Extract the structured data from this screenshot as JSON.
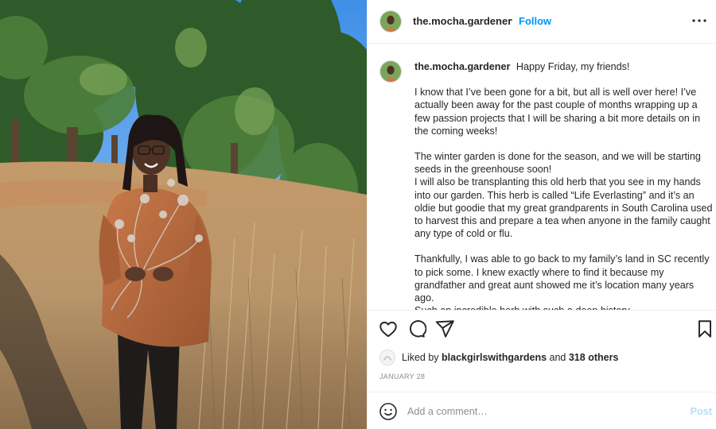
{
  "post": {
    "username": "the.mocha.gardener",
    "follow_label": "Follow",
    "separator": "·",
    "photo_alt": "Woman in a rust sweater holding dried herbs in a pine field"
  },
  "caption": {
    "username": "the.mocha.gardener",
    "first_line": "Happy Friday, my friends!",
    "paragraphs": [
      "I know that I’ve been gone for a bit, but all is well over here! I’ve actually been away for the past couple of months wrapping up a few passion projects that I will be sharing a bit more details on in the coming weeks!",
      "The winter garden is done for the season, and we will be starting seeds in the greenhouse soon!\nI will also be transplanting this old herb that you see in my hands into our garden. This herb is called “Life Everlasting” and it’s an oldie but goodie that my great grandparents in South Carolina used to harvest this and prepare a tea when anyone in the family caught any type of cold or flu.",
      "Thankfully, I was able to go back to my family’s land in SC recently to pick some. I knew exactly where to find it because my grandfather and great aunt showed me it’s location many years ago.\nSuch an incredible herb with such a deep history."
    ]
  },
  "actions": {
    "icons": [
      "heart-icon",
      "comment-icon",
      "share-icon",
      "bookmark-icon"
    ]
  },
  "likes": {
    "prefix": "Liked by",
    "user": "blackgirlswithgardens",
    "conjunction": "and",
    "others": "318 others"
  },
  "date": "JANUARY 28",
  "comment": {
    "placeholder": "Add a comment…",
    "post_label": "Post"
  },
  "colors": {
    "link_blue": "#0095f6",
    "post_disabled": "#b2dffc",
    "text": "#262626",
    "muted": "#8e8e8e"
  }
}
